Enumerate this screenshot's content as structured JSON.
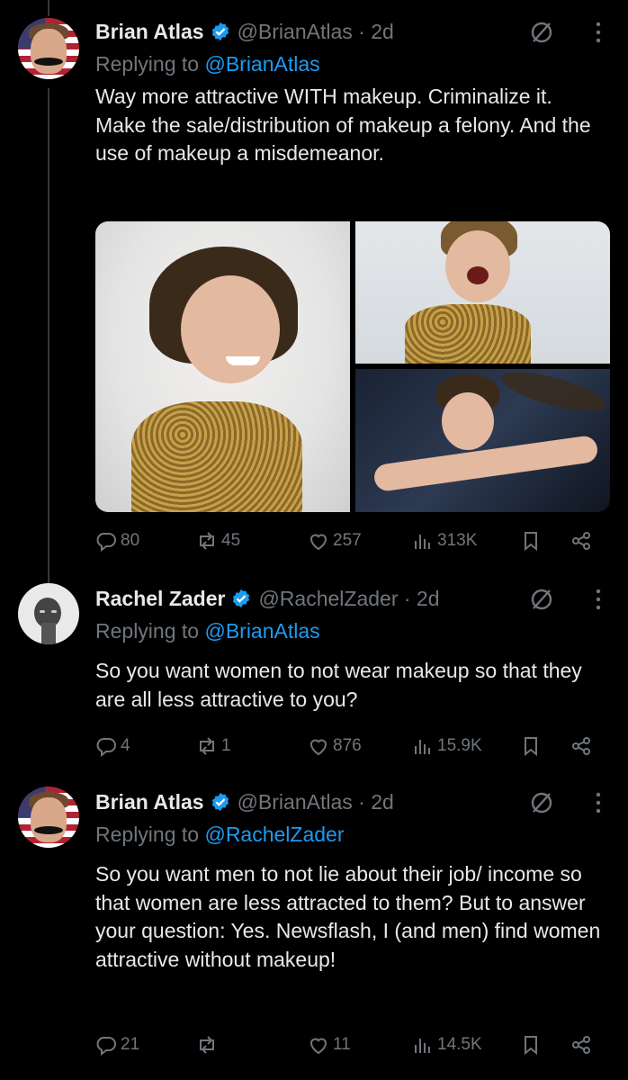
{
  "tweets": [
    {
      "name": "Brian Atlas",
      "handle": "@BrianAtlas · 2d",
      "replying_prefix": "Replying to ",
      "replying_to": "@BrianAtlas",
      "text": "Way more attractive WITH makeup. Criminalize it. Make the sale/distribution of makeup a felony. And the use of makeup a misdemeanor.",
      "stats": {
        "replies": "80",
        "reposts": "45",
        "likes": "257",
        "views": "313K"
      }
    },
    {
      "name": "Rachel Zader",
      "handle": "@RachelZader · 2d",
      "replying_prefix": "Replying to ",
      "replying_to": "@BrianAtlas",
      "text": "So you want women to not wear makeup so that they are all less attractive to you?",
      "stats": {
        "replies": "4",
        "reposts": "1",
        "likes": "876",
        "views": "15.9K"
      }
    },
    {
      "name": "Brian Atlas",
      "handle": "@BrianAtlas · 2d",
      "replying_prefix": "Replying to ",
      "replying_to": "@RachelZader",
      "text": "So you want men to not lie about their job/ income so that women are less attracted to them? But to answer your question: Yes. Newsflash, I (and men) find women attractive without makeup!",
      "stats": {
        "replies": "21",
        "reposts": "",
        "likes": "11",
        "views": "14.5K"
      }
    }
  ],
  "icons": {
    "verified": "verified-badge-icon",
    "grok": "grok-icon",
    "more": "more-options-icon",
    "reply": "reply-icon",
    "repost": "repost-icon",
    "like": "like-icon",
    "views": "views-icon",
    "bookmark": "bookmark-icon",
    "share": "share-icon"
  },
  "colors": {
    "background": "#000000",
    "text": "#e7e9ea",
    "muted": "#71767b",
    "link": "#1d9bf0",
    "verified": "#1d9bf0"
  }
}
